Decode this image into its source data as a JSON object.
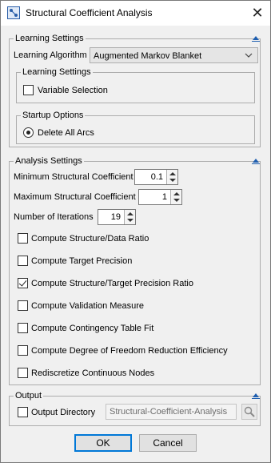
{
  "window": {
    "title": "Structural Coefficient Analysis",
    "close_glyph": "✕",
    "app_icon": "bayesian-network-icon"
  },
  "learning_settings": {
    "title": "Learning Settings",
    "algorithm_label": "Learning Algorithm",
    "algorithm_value": "Augmented Markov Blanket",
    "inner_group_title": "Learning Settings",
    "variable_selection_label": "Variable Selection",
    "variable_selection_checked": false,
    "startup_title": "Startup Options",
    "delete_all_arcs_label": "Delete All Arcs",
    "delete_all_arcs_selected": true
  },
  "analysis_settings": {
    "title": "Analysis Settings",
    "min_coef_label": "Minimum Structural Coefficient",
    "min_coef_value": "0.1",
    "max_coef_label": "Maximum Structural Coefficient",
    "max_coef_value": "1",
    "iterations_label": "Number of Iterations",
    "iterations_value": "19",
    "options": [
      {
        "label": "Compute Structure/Data Ratio",
        "checked": false
      },
      {
        "label": "Compute Target Precision",
        "checked": false
      },
      {
        "label": "Compute Structure/Target Precision Ratio",
        "checked": true
      },
      {
        "label": "Compute Validation Measure",
        "checked": false
      },
      {
        "label": "Compute Contingency Table Fit",
        "checked": false
      },
      {
        "label": "Compute Degree of Freedom Reduction Efficiency",
        "checked": false
      },
      {
        "label": "Rediscretize Continuous Nodes",
        "checked": false
      }
    ]
  },
  "output": {
    "title": "Output",
    "directory_label": "Output Directory",
    "directory_checked": false,
    "directory_value": "Structural-Coefficient-Analysis"
  },
  "buttons": {
    "ok": "OK",
    "cancel": "Cancel"
  },
  "colors": {
    "accent": "#0078d7",
    "collapse_arrow": "#1f5fb0"
  }
}
